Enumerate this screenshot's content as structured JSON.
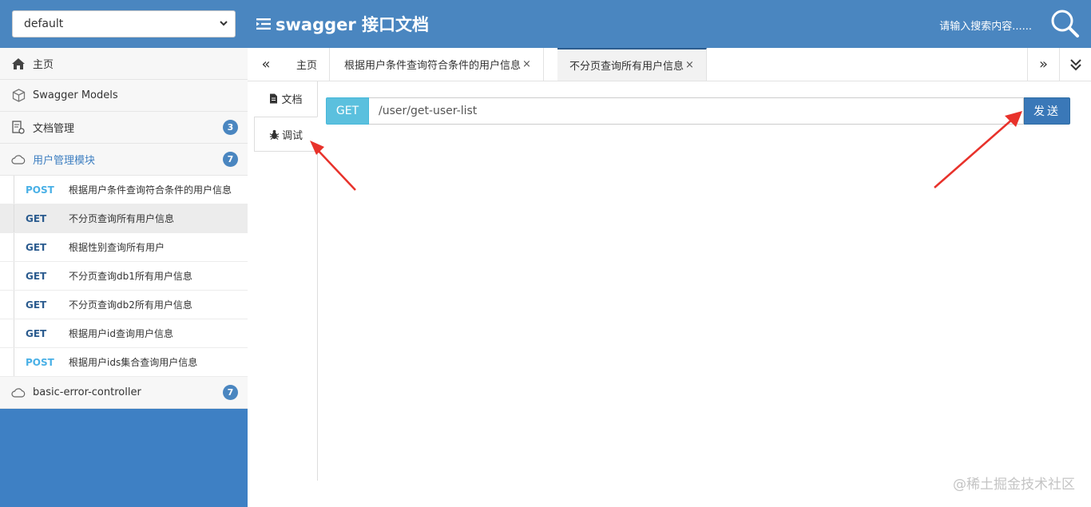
{
  "header": {
    "group_select_value": "default",
    "title": "swagger 接口文档",
    "search_placeholder": "请输入搜索内容......"
  },
  "sidebar": {
    "items": [
      {
        "label": "主页",
        "icon": "home-icon"
      },
      {
        "label": "Swagger Models",
        "icon": "cube-icon"
      },
      {
        "label": "文档管理",
        "icon": "doc-settings-icon",
        "badge": "3"
      },
      {
        "label": "用户管理模块",
        "icon": "cloud-icon",
        "badge": "7"
      }
    ],
    "apis": [
      {
        "method": "POST",
        "title": "根据用户条件查询符合条件的用户信息"
      },
      {
        "method": "GET",
        "title": "不分页查询所有用户信息"
      },
      {
        "method": "GET",
        "title": "根据性别查询所有用户"
      },
      {
        "method": "GET",
        "title": "不分页查询db1所有用户信息"
      },
      {
        "method": "GET",
        "title": "不分页查询db2所有用户信息"
      },
      {
        "method": "GET",
        "title": "根据用户id查询用户信息"
      },
      {
        "method": "POST",
        "title": "根据用户ids集合查询用户信息"
      }
    ],
    "last_group": {
      "label": "basic-error-controller",
      "badge": "7"
    }
  },
  "tabs": [
    {
      "label": "主页"
    },
    {
      "label": "根据用户条件查询符合条件的用户信息",
      "close": "×"
    },
    {
      "label": "不分页查询所有用户信息",
      "close": "×"
    }
  ],
  "tab_nav": {
    "prev": "«",
    "next": "»"
  },
  "vtabs": [
    {
      "label": "文档",
      "icon": "file-icon"
    },
    {
      "label": "调试",
      "icon": "bug-icon"
    }
  ],
  "request": {
    "method": "GET",
    "url": "/user/get-user-list",
    "send_label": "发送"
  },
  "watermark": "@稀土掘金技术社区",
  "colors": {
    "header": "#4a86c0",
    "sidebar_bg": "#3e80c4",
    "get_badge": "#5bc0de",
    "send_button": "#3a78b8",
    "arrow": "#e8322b"
  }
}
